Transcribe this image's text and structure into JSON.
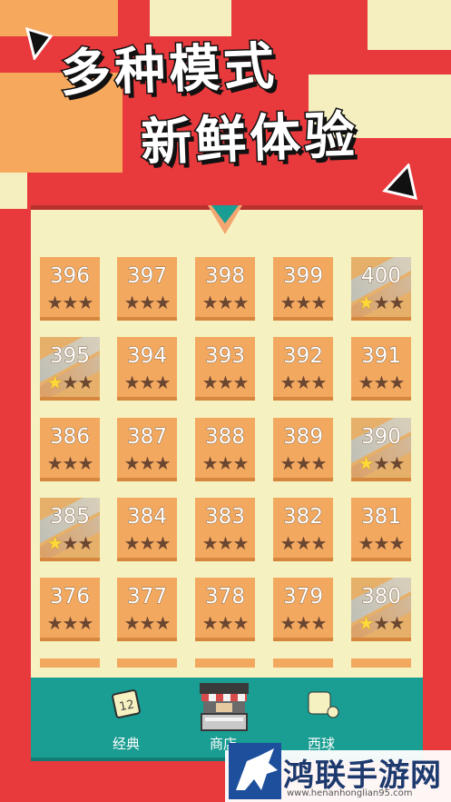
{
  "hero": {
    "line1": "多种模式",
    "line2": "新鲜体验"
  },
  "colors": {
    "background": "#e8393c",
    "panel": "#f6f1c1",
    "tile": "#f2a85f",
    "nav": "#1a9d92",
    "star_on": "#ffd83a",
    "star_off": "#6b4630"
  },
  "levels": [
    [
      {
        "n": "396",
        "stars": 0
      },
      {
        "n": "397",
        "stars": 0
      },
      {
        "n": "398",
        "stars": 0
      },
      {
        "n": "399",
        "stars": 0
      },
      {
        "n": "400",
        "stars": 1,
        "done": true
      }
    ],
    [
      {
        "n": "395",
        "stars": 1,
        "done": true
      },
      {
        "n": "394",
        "stars": 0
      },
      {
        "n": "393",
        "stars": 0
      },
      {
        "n": "392",
        "stars": 0
      },
      {
        "n": "391",
        "stars": 0
      }
    ],
    [
      {
        "n": "386",
        "stars": 0
      },
      {
        "n": "387",
        "stars": 0
      },
      {
        "n": "388",
        "stars": 0
      },
      {
        "n": "389",
        "stars": 0
      },
      {
        "n": "390",
        "stars": 1,
        "done": true
      }
    ],
    [
      {
        "n": "385",
        "stars": 1,
        "done": true
      },
      {
        "n": "384",
        "stars": 0
      },
      {
        "n": "383",
        "stars": 0
      },
      {
        "n": "382",
        "stars": 0
      },
      {
        "n": "381",
        "stars": 0
      }
    ],
    [
      {
        "n": "376",
        "stars": 0
      },
      {
        "n": "377",
        "stars": 0
      },
      {
        "n": "378",
        "stars": 0
      },
      {
        "n": "379",
        "stars": 0
      },
      {
        "n": "380",
        "stars": 1,
        "done": true
      }
    ]
  ],
  "nav": {
    "classic": {
      "label": "经典",
      "icon": "dice-12-icon"
    },
    "shop": {
      "label": "商店",
      "icon": "shop-stall-icon"
    },
    "ball": {
      "label": "西球",
      "icon": "ball-icon"
    }
  },
  "watermark": {
    "text": "鸿联手游网",
    "url": "www.henanhonglian95.com",
    "icon": "horse-logo-icon"
  }
}
